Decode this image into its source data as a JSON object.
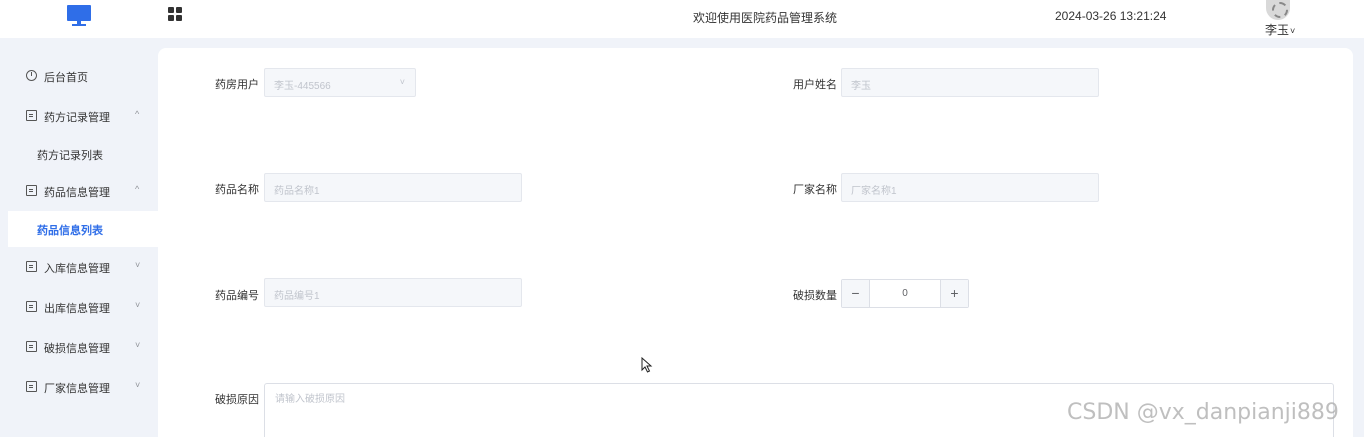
{
  "header": {
    "system_title": "欢迎使用医院药品管理系统",
    "datetime": "2024-03-26 13:21:24",
    "username": "李玉",
    "caret": "˅"
  },
  "sidebar": {
    "items": [
      {
        "label": "后台首页",
        "icon": "clock-icon",
        "arrow": ""
      },
      {
        "label": "药方记录管理",
        "icon": "card-icon",
        "arrow": "^"
      },
      {
        "label": "药方记录列表",
        "sub": true
      },
      {
        "label": "药品信息管理",
        "icon": "card-icon",
        "arrow": "^"
      },
      {
        "label": "药品信息列表",
        "sub": true,
        "active": true
      },
      {
        "label": "入库信息管理",
        "icon": "card-icon",
        "arrow": "˅"
      },
      {
        "label": "出库信息管理",
        "icon": "card-icon",
        "arrow": "˅"
      },
      {
        "label": "破损信息管理",
        "icon": "card-icon",
        "arrow": "˅"
      },
      {
        "label": "厂家信息管理",
        "icon": "card-icon",
        "arrow": "˅"
      }
    ]
  },
  "form": {
    "pharmacy_user": {
      "label": "药房用户",
      "value": "李玉-445566",
      "arrow": "˅"
    },
    "user_name": {
      "label": "用户姓名",
      "value": "李玉"
    },
    "drug_name": {
      "label": "药品名称",
      "placeholder": "药品名称1"
    },
    "maker_name": {
      "label": "厂家名称",
      "placeholder": "厂家名称1"
    },
    "drug_code": {
      "label": "药品编号",
      "placeholder": "药品编号1"
    },
    "damage_qty": {
      "label": "破损数量",
      "value": "0",
      "minus": "−",
      "plus": "+"
    },
    "damage_reason": {
      "label": "破损原因",
      "placeholder": "请输入破损原因"
    }
  },
  "watermark": "CSDN @vx_danpianji889",
  "colors": {
    "accent": "#2f6ee8",
    "page_bg": "#f0f3f9",
    "card_bg": "#ffffff"
  }
}
